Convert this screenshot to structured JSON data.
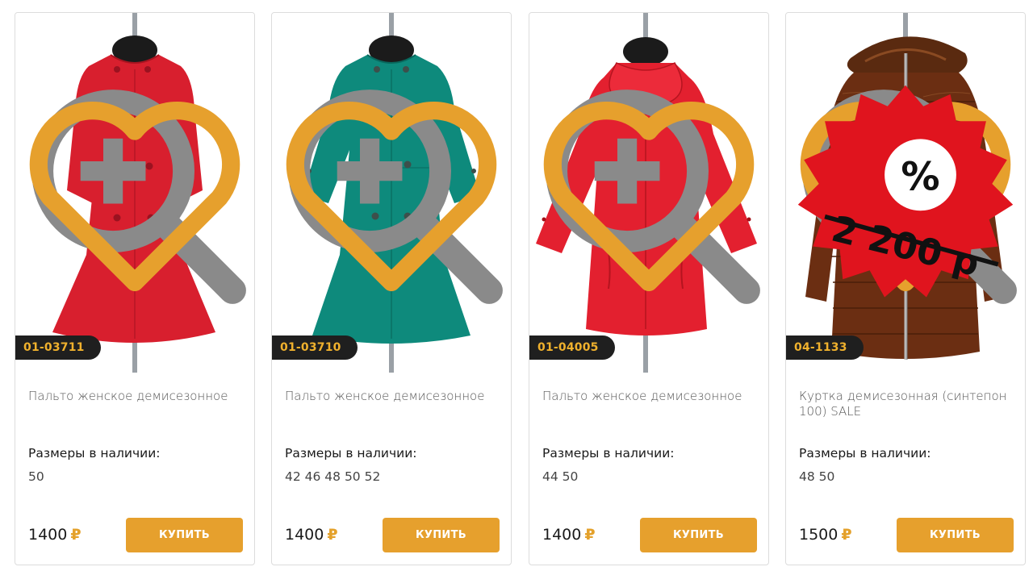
{
  "products": [
    {
      "sku": "01-03711",
      "title": "Пальто женское демисезонное",
      "sizes_label": "Размеры в наличии:",
      "sizes": "50",
      "price": "1400",
      "currency": "₽",
      "buy_label": "КУПИТЬ",
      "garment_color": "#d81f2e",
      "image": "red-coat-double-breasted"
    },
    {
      "sku": "01-03710",
      "title": "Пальто женское демисезонное",
      "sizes_label": "Размеры в наличии:",
      "sizes": "42 46 48 50 52",
      "price": "1400",
      "currency": "₽",
      "buy_label": "КУПИТЬ",
      "garment_color": "#0e8a7c",
      "image": "teal-coat-double-breasted"
    },
    {
      "sku": "01-04005",
      "title": "Пальто женское демисезонное",
      "sizes_label": "Размеры в наличии:",
      "sizes": "44 50",
      "price": "1400",
      "currency": "₽",
      "buy_label": "КУПИТЬ",
      "garment_color": "#e3202f",
      "image": "red-coat-collar"
    },
    {
      "sku": "04-1133",
      "title": "Куртка демисезонная (синтепон 100) SALE",
      "sizes_label": "Размеры в наличии:",
      "sizes": "48 50",
      "price": "1500",
      "currency": "₽",
      "buy_label": "КУПИТЬ",
      "garment_color": "#6b2e12",
      "image": "brown-quilted-jacket",
      "sale": {
        "percent_symbol": "%",
        "old_price": "2 200 р"
      }
    }
  ],
  "colors": {
    "accent": "#e6a02d",
    "sku_bg": "#1f1f1f",
    "sku_text": "#f0b12d",
    "sale_red": "#e0141e"
  },
  "icons": [
    "zoom-icon",
    "heart-icon"
  ]
}
